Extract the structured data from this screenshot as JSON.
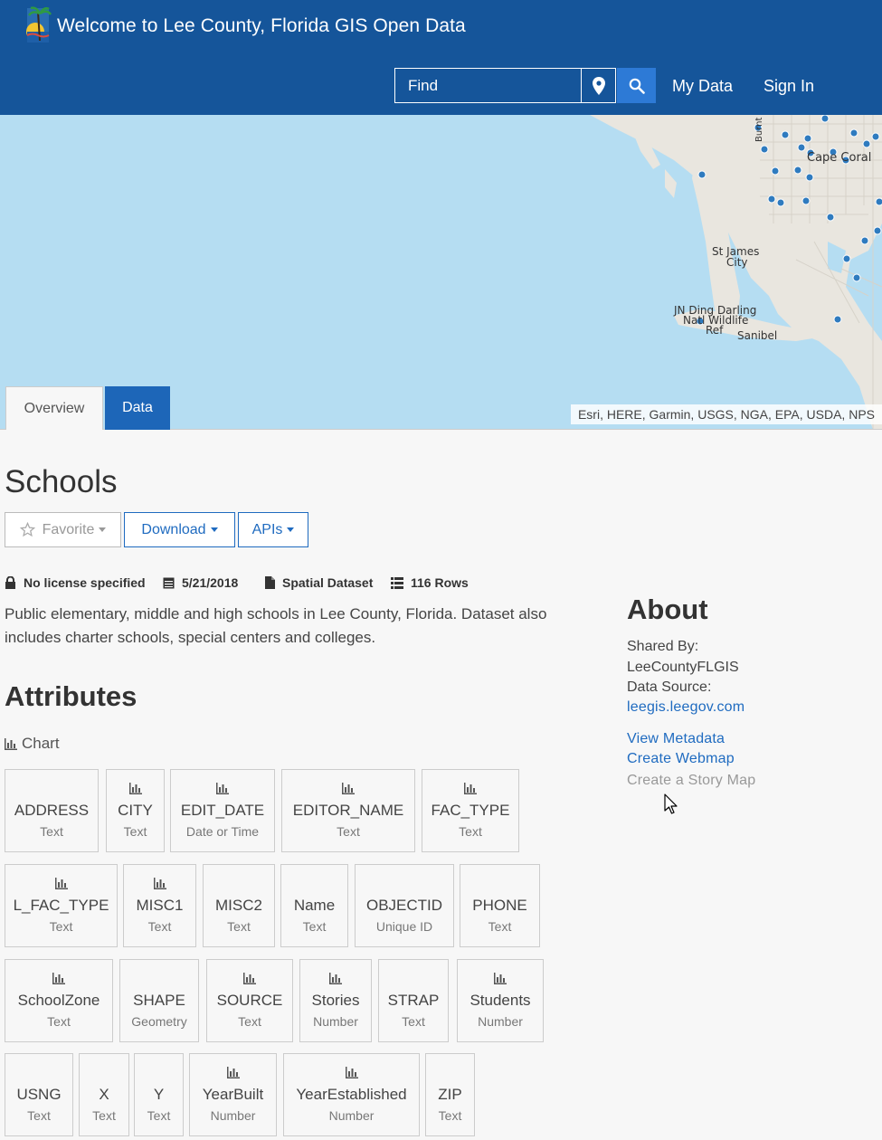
{
  "header": {
    "title": "Welcome to Lee County, Florida GIS Open Data",
    "search_placeholder": "Find",
    "my_data": "My Data",
    "sign_in": "Sign In"
  },
  "map": {
    "labels": [
      "Cape Coral",
      "St James City",
      "JN Ding Darling Natl Wildlife Ref",
      "Sanibel",
      "Burnt"
    ],
    "label_lines": {
      "cape_coral": "Cape Coral",
      "st_james_1": "St James",
      "st_james_2": "City",
      "ding_1": "JN Ding Darling",
      "ding_2": "Natl Wildlife",
      "ding_3": "Ref",
      "sanibel": "Sanibel",
      "burnt": "Burnt"
    },
    "attribution": "Esri, HERE, Garmin, USGS, NGA, EPA, USDA, NPS",
    "colors": {
      "water": "#b5ddf2",
      "land": "#e9e6df",
      "point": "#2f7bbf"
    }
  },
  "tabs": {
    "overview": "Overview",
    "data": "Data"
  },
  "page_title": "Schools",
  "actions": {
    "favorite": "Favorite",
    "download": "Download",
    "apis": "APIs"
  },
  "meta": {
    "license": "No license specified",
    "date": "5/21/2018",
    "type": "Spatial Dataset",
    "rows": "116 Rows"
  },
  "description": "Public elementary, middle and high schools in Lee County, Florida. Dataset also includes charter schools, special centers and colleges.",
  "attributes_title": "Attributes",
  "chart_label": "Chart",
  "attributes": [
    {
      "name": "ADDRESS",
      "type": "Text",
      "chart": false
    },
    {
      "name": "CITY",
      "type": "Text",
      "chart": true
    },
    {
      "name": "EDIT_DATE",
      "type": "Date or Time",
      "chart": true
    },
    {
      "name": "EDITOR_NAME",
      "type": "Text",
      "chart": true
    },
    {
      "name": "FAC_TYPE",
      "type": "Text",
      "chart": true
    },
    {
      "name": "L_FAC_TYPE",
      "type": "Text",
      "chart": true
    },
    {
      "name": "MISC1",
      "type": "Text",
      "chart": true
    },
    {
      "name": "MISC2",
      "type": "Text",
      "chart": false
    },
    {
      "name": "Name",
      "type": "Text",
      "chart": false
    },
    {
      "name": "OBJECTID",
      "type": "Unique ID",
      "chart": false
    },
    {
      "name": "PHONE",
      "type": "Text",
      "chart": false
    },
    {
      "name": "SchoolZone",
      "type": "Text",
      "chart": true
    },
    {
      "name": "SHAPE",
      "type": "Geometry",
      "chart": false
    },
    {
      "name": "SOURCE",
      "type": "Text",
      "chart": true
    },
    {
      "name": "Stories",
      "type": "Number",
      "chart": true
    },
    {
      "name": "STRAP",
      "type": "Text",
      "chart": false
    },
    {
      "name": "Students",
      "type": "Number",
      "chart": true
    },
    {
      "name": "USNG",
      "type": "Text",
      "chart": false
    },
    {
      "name": "X",
      "type": "Text",
      "chart": false
    },
    {
      "name": "Y",
      "type": "Text",
      "chart": false
    },
    {
      "name": "YearBuilt",
      "type": "Number",
      "chart": true
    },
    {
      "name": "YearEstablished",
      "type": "Number",
      "chart": true
    },
    {
      "name": "ZIP",
      "type": "Text",
      "chart": false
    }
  ],
  "about": {
    "title": "About",
    "shared_by_label": "Shared By:",
    "shared_by": "LeeCountyFLGIS",
    "data_source_label": "Data Source:",
    "data_source": "leegis.leegov.com",
    "view_metadata": "View Metadata",
    "create_webmap": "Create Webmap",
    "create_story_map": "Create a Story Map"
  },
  "colors": {
    "header": "#15559a",
    "accent": "#1f6bc0",
    "search_button": "#2d7ad6"
  }
}
